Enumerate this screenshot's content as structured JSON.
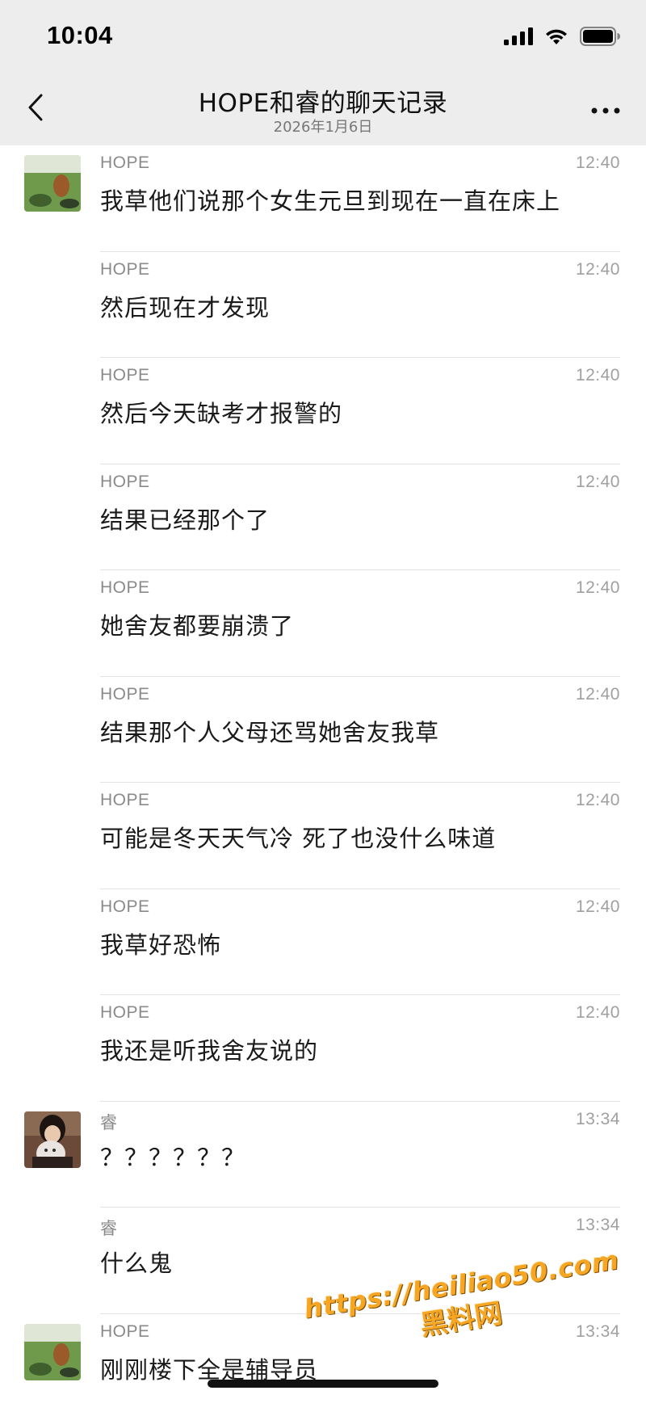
{
  "status_bar": {
    "time": "10:04",
    "icons": [
      "signal-icon",
      "wifi-icon",
      "battery-icon"
    ]
  },
  "nav": {
    "title": "HOPE和睿的聊天记录",
    "subtitle": "2026年1月6日",
    "back_icon": "chevron-left-icon",
    "more_icon": "more-dots-icon"
  },
  "messages": [
    {
      "sender": "HOPE",
      "time": "12:40",
      "text": "我草他们说那个女生元旦到现在一直在床上",
      "avatar": "hope"
    },
    {
      "sender": "HOPE",
      "time": "12:40",
      "text": "然后现在才发现",
      "avatar": ""
    },
    {
      "sender": "HOPE",
      "time": "12:40",
      "text": "然后今天缺考才报警的",
      "avatar": ""
    },
    {
      "sender": "HOPE",
      "time": "12:40",
      "text": "结果已经那个了",
      "avatar": ""
    },
    {
      "sender": "HOPE",
      "time": "12:40",
      "text": "她舍友都要崩溃了",
      "avatar": ""
    },
    {
      "sender": "HOPE",
      "time": "12:40",
      "text": "结果那个人父母还骂她舍友我草",
      "avatar": ""
    },
    {
      "sender": "HOPE",
      "time": "12:40",
      "text": "可能是冬天天气冷 死了也没什么味道",
      "avatar": ""
    },
    {
      "sender": "HOPE",
      "time": "12:40",
      "text": "我草好恐怖",
      "avatar": ""
    },
    {
      "sender": "HOPE",
      "time": "12:40",
      "text": "我还是听我舍友说的",
      "avatar": ""
    },
    {
      "sender": "睿",
      "time": "13:34",
      "text": "？？？？？？",
      "avatar": "rui"
    },
    {
      "sender": "睿",
      "time": "13:34",
      "text": "什么鬼",
      "avatar": ""
    },
    {
      "sender": "HOPE",
      "time": "13:34",
      "text": "刚刚楼下全是辅导员",
      "avatar": "hope"
    }
  ],
  "watermark": {
    "url": "https://heiliao50.com",
    "name": "黑料网",
    "color": "#f6a623"
  },
  "colors": {
    "header_bg": "#ededed",
    "page_bg": "#ffffff",
    "meta_text": "#8a8a8a"
  }
}
